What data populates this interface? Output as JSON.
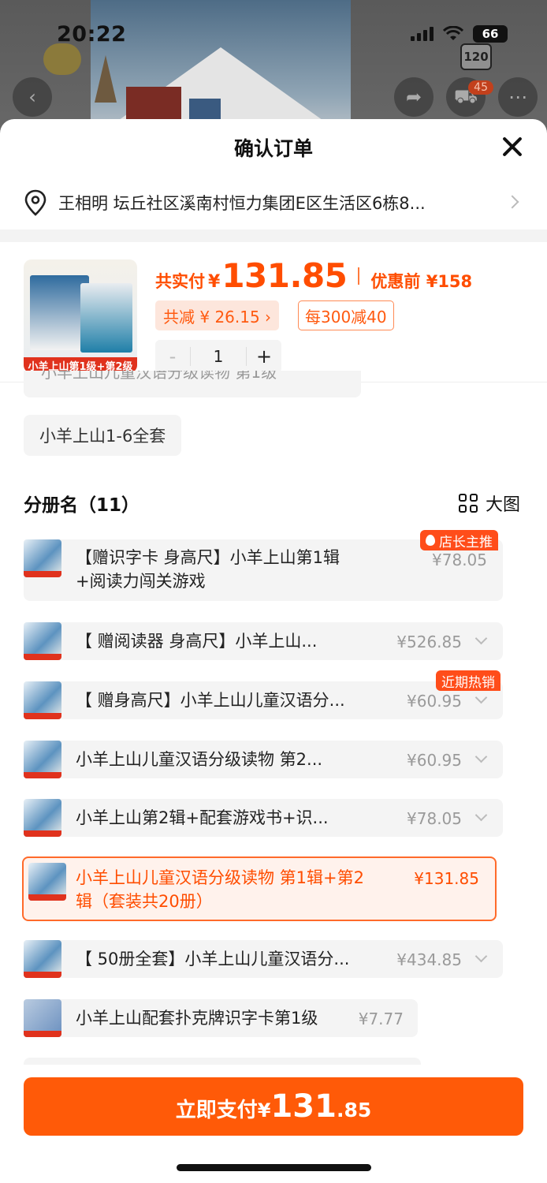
{
  "status": {
    "time": "20:22",
    "battery": "66"
  },
  "background": {
    "cart_count": "45",
    "badge": "120"
  },
  "header": {
    "title": "确认订单"
  },
  "address": {
    "text": "王相明 坛丘社区溪南村恒力集团E区生活区6栋8..."
  },
  "product": {
    "thumb_caption": "小羊上山第1级+第2级",
    "pay_label": "共实付",
    "currency": "¥",
    "pay_amount": "131.85",
    "before_label": "优惠前 ¥158",
    "reduce_tag": "共减 ¥ 26.15 ›",
    "promo_tag": "每300减40",
    "quantity": "1",
    "minus": "-",
    "plus": "+"
  },
  "options": {
    "cut_label": "小羊上山儿童汉语分级读物 第1级",
    "set_label": "小羊上山1-6全套",
    "section_title": "分册名（11）",
    "grid_label": "大图",
    "items": [
      {
        "name": "【赠识字卡 身高尺】小羊上山第1辑",
        "name2": "+阅读力闯关游戏",
        "price": "¥78.05",
        "flag": "店长主推"
      },
      {
        "name": "【 赠阅读器 身高尺】小羊上山...",
        "price": "¥526.85"
      },
      {
        "name": "【 赠身高尺】小羊上山儿童汉语分...",
        "price": "¥60.95",
        "flag": "近期热销"
      },
      {
        "name": "小羊上山儿童汉语分级读物 第2...",
        "price": "¥60.95"
      },
      {
        "name": "小羊上山第2辑+配套游戏书+识...",
        "price": "¥78.05"
      },
      {
        "name": "小羊上山儿童汉语分级读物 第1辑+第2",
        "name2": "辑（套装共20册）",
        "price": "¥131.85",
        "selected": true
      },
      {
        "name": "【 50册全套】小羊上山儿童汉语分...",
        "price": "¥434.85"
      },
      {
        "name": "小羊上山配套扑克牌识字卡第1级",
        "price": "¥7.77"
      }
    ]
  },
  "footer": {
    "pay_label": "立即支付",
    "currency": "¥",
    "amount_int": "131",
    "amount_dec": ".85"
  },
  "colors": {
    "accent": "#ff5a08",
    "price": "#ff4d00",
    "flag": "#ff4d1a"
  }
}
